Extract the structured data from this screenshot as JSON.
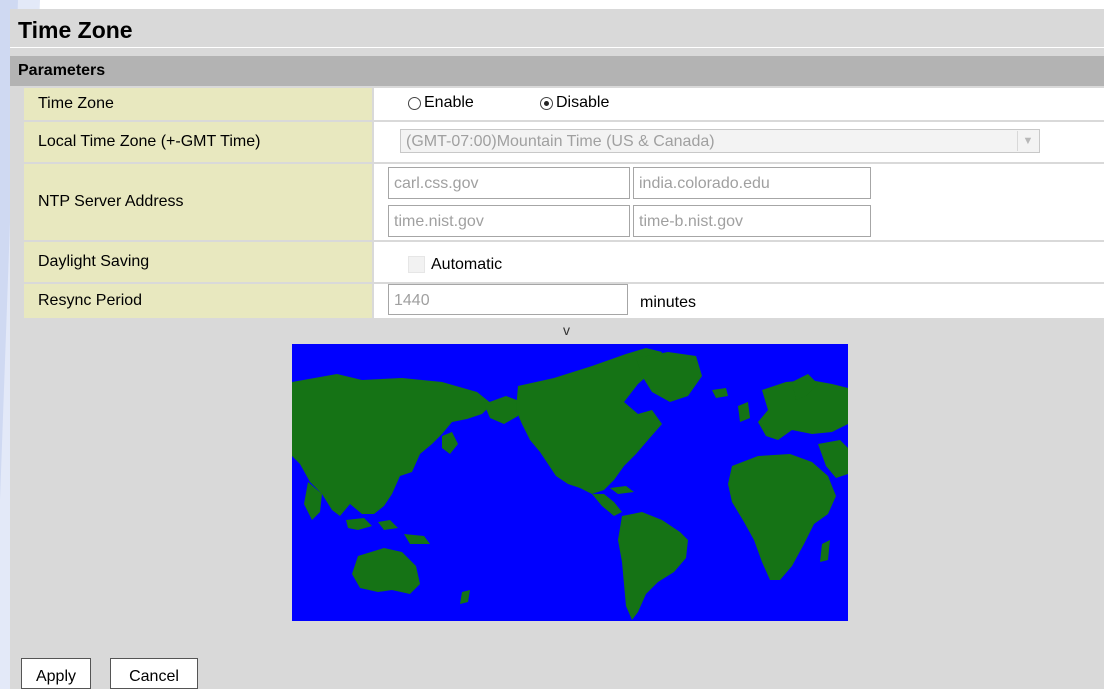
{
  "page": {
    "title": "Time Zone",
    "section": "Parameters"
  },
  "time_zone": {
    "label": "Time Zone",
    "options": [
      {
        "label": "Enable",
        "checked": false
      },
      {
        "label": "Disable",
        "checked": true
      }
    ]
  },
  "local_time_zone": {
    "label": "Local Time Zone (+-GMT Time)",
    "selected": "(GMT-07:00)Mountain Time (US & Canada)"
  },
  "ntp": {
    "label": "NTP Server Address",
    "servers": [
      "carl.css.gov",
      "india.colorado.edu",
      "time.nist.gov",
      "time-b.nist.gov"
    ]
  },
  "daylight": {
    "label": "Daylight Saving",
    "option": "Automatic",
    "checked": false
  },
  "resync": {
    "label": "Resync Period",
    "value": "1440",
    "unit": "minutes"
  },
  "map": {
    "marker": "v",
    "ocean_color": "#0000ff",
    "land_color": "#157315"
  },
  "buttons": {
    "apply": "Apply",
    "cancel": "Cancel"
  },
  "colors": {
    "label_bg": "#e8e8bf",
    "section_bg": "#b3b3b3",
    "panel_bg": "#d9d9d9"
  }
}
